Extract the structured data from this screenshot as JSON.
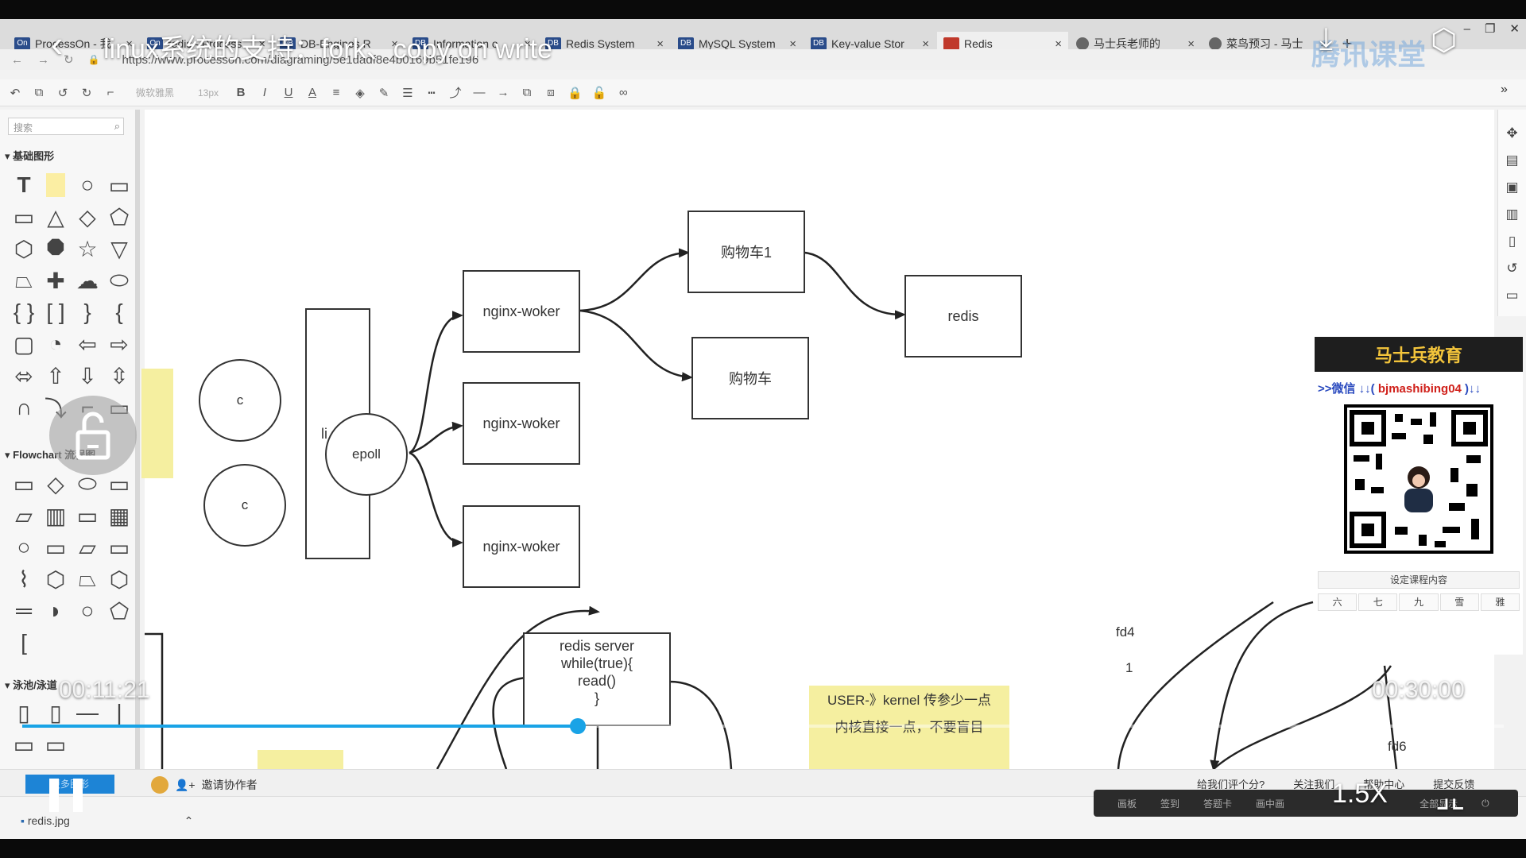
{
  "browser": {
    "tabs": [
      {
        "icon": "On",
        "label": "ProcessOn - 我",
        "red": false
      },
      {
        "icon": "On",
        "label": "redis - Process",
        "red": false
      },
      {
        "icon": "DB",
        "label": "DB-Engines R",
        "red": false
      },
      {
        "icon": "DB",
        "label": "Information o",
        "red": false
      },
      {
        "icon": "DB",
        "label": "Redis System",
        "red": false
      },
      {
        "icon": "DB",
        "label": "MySQL System",
        "red": false
      },
      {
        "icon": "DB",
        "label": "Key-value Stor",
        "red": false
      },
      {
        "icon": "",
        "label": "Redis",
        "red": true
      },
      {
        "icon": "",
        "label": "马士兵老师的",
        "red": false
      },
      {
        "icon": "",
        "label": "菜鸟预习 - 马士",
        "red": false
      }
    ],
    "new_tab": "+",
    "url": "https://www.processon.com/diagraming/5e1dadf8e4b0169b51fe196"
  },
  "toolbar": {
    "font_name": "微软雅黑",
    "font_size": "13px",
    "bold": "B",
    "italic": "I",
    "underline": "U",
    "font_color": "A"
  },
  "left_panel": {
    "search_placeholder": "搜索",
    "section_basic": "基础图形",
    "section_flowchart": "Flowchart 流程图",
    "section_swimlane": "泳池/泳道"
  },
  "diagram": {
    "client1": "c",
    "client2": "c",
    "kernel_label": "li",
    "epoll": "epoll",
    "worker1": "nginx-woker",
    "worker2": "nginx-woker",
    "worker3": "nginx-woker",
    "cart1": "购物车1",
    "cart2": "购物车",
    "redis": "redis",
    "server_lines": [
      "redis  server",
      "while(true){",
      "read()",
      "}"
    ],
    "note_line1": "USER-》kernel  传参少一点",
    "note_line2": "内核直接一点，不要盲目",
    "fd4": "fd4",
    "fd_one": "1",
    "fd6": "fd6"
  },
  "promo": {
    "title": "马士兵教育",
    "wechat_prefix": ">>微信 ↓↓( ",
    "wechat_id": "bjmashibing04",
    "wechat_suffix": " )↓↓",
    "course_label": "设定课程内容",
    "days": [
      "六",
      "七",
      "九",
      "雪",
      "雅"
    ]
  },
  "bottom": {
    "blue_button": "更多图形",
    "invite": "邀请协作者",
    "feedback": [
      "给我们评个分?",
      "关注我们",
      "帮助中心",
      "提交反馈"
    ],
    "file": "redis.jpg",
    "tray_items": [
      "画板",
      "签到",
      "答题卡",
      "画中画",
      "全部显示"
    ]
  },
  "video": {
    "title": "linux系统的支持：fork、copy on write",
    "current_time": "00:11:21",
    "total_time": "00:30:00",
    "progress": 0.375,
    "speed": "1.5X",
    "brand": "腾讯课堂"
  }
}
